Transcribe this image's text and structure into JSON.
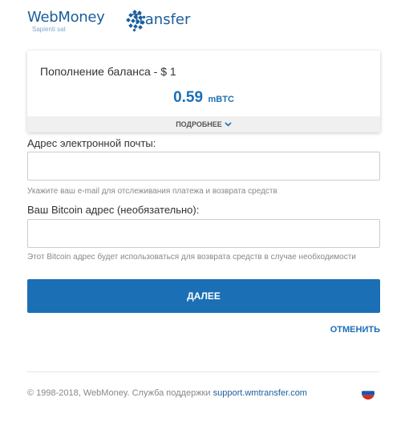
{
  "brand": {
    "name": "WebMoney",
    "tagline": "Sapienti sat",
    "product": "Transfer"
  },
  "summary": {
    "title": "Пополнение баланса - $ 1",
    "amount": "0.59",
    "unit": "mBTC",
    "details_label": "ПОДРОБНЕЕ"
  },
  "form": {
    "email_label": "Адрес электронной почты:",
    "email_value": "",
    "email_hint": "Укажите ваш e-mail для отслеживания платежа и возврата средств",
    "bitcoin_label": "Ваш Bitcoin адрес (необязательно):",
    "bitcoin_value": "",
    "bitcoin_hint": "Этот Bitcoin адрес будет использоваться для возврата средств в случае необходимости",
    "submit_label": "ДАЛЕЕ",
    "cancel_label": "ОТМЕНИТЬ"
  },
  "footer": {
    "copyright": "© 1998-2018, WebMoney. Служба поддержки",
    "support_link": "support.wmtransfer.com",
    "language_flag": "russia-flag-icon"
  },
  "colors": {
    "brand_blue": "#1b5e9c",
    "accent_blue": "#1b6fb5",
    "hint_gray": "#888888"
  }
}
